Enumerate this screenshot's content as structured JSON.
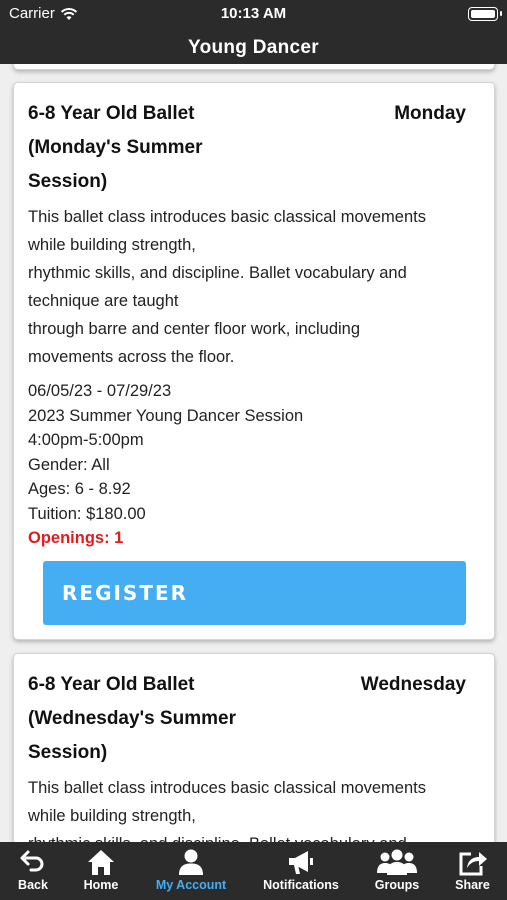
{
  "status_bar": {
    "carrier": "Carrier",
    "time": "10:13 AM"
  },
  "nav": {
    "title": "Young Dancer"
  },
  "classes": [
    {
      "title": "6-8 Year Old Ballet (Monday's Summer Session)",
      "day": "Monday",
      "description": [
        "This ballet class introduces basic classical movements",
        "while building strength,",
        "rhythmic skills, and discipline. Ballet vocabulary and",
        "technique are taught",
        "through barre and center floor work, including",
        "movements across the floor."
      ],
      "dates": "06/05/23 - 07/29/23",
      "session": "2023 Summer Young Dancer Session",
      "time": "4:00pm-5:00pm",
      "gender": "Gender: All",
      "ages": "Ages: 6 - 8.92",
      "tuition": "Tuition: $180.00",
      "openings": "Openings: 1",
      "register_label": "REGISTER"
    },
    {
      "title": "6-8 Year Old Ballet (Wednesday's Summer Session)",
      "day": "Wednesday",
      "description": [
        "This ballet class introduces basic classical movements",
        "while building strength,",
        "rhythmic skills, and discipline. Ballet vocabulary and"
      ]
    }
  ],
  "tab_bar": {
    "items": [
      {
        "label": "Back",
        "icon": "back-arrow-icon"
      },
      {
        "label": "Home",
        "icon": "home-icon"
      },
      {
        "label": "My Account",
        "icon": "user-icon",
        "active": true
      },
      {
        "label": "Notifications",
        "icon": "megaphone-icon"
      },
      {
        "label": "Groups",
        "icon": "group-icon"
      },
      {
        "label": "Share",
        "icon": "share-icon"
      }
    ]
  },
  "colors": {
    "bar_background": "#2b2b2b",
    "register_button": "#45aef2",
    "active_tab": "#45aef2",
    "openings": "#e41b1b"
  }
}
